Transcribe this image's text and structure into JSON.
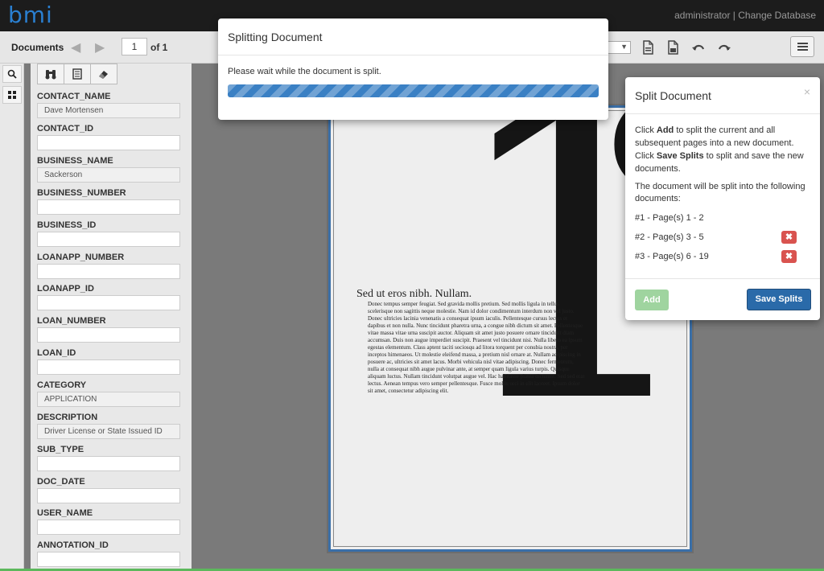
{
  "header": {
    "logo_text": "bmi",
    "user_links": "administrator | Change Database"
  },
  "toolbar": {
    "title": "Documents",
    "page_value": "1",
    "page_of": "of 1"
  },
  "fields": [
    {
      "label": "CONTACT_NAME",
      "value": "Dave Mortensen"
    },
    {
      "label": "CONTACT_ID",
      "value": ""
    },
    {
      "label": "BUSINESS_NAME",
      "value": "Sackerson"
    },
    {
      "label": "BUSINESS_NUMBER",
      "value": ""
    },
    {
      "label": "BUSINESS_ID",
      "value": ""
    },
    {
      "label": "LOANAPP_NUMBER",
      "value": ""
    },
    {
      "label": "LOANAPP_ID",
      "value": ""
    },
    {
      "label": "LOAN_NUMBER",
      "value": ""
    },
    {
      "label": "LOAN_ID",
      "value": ""
    },
    {
      "label": "CATEGORY",
      "value": "APPLICATION"
    },
    {
      "label": "DESCRIPTION",
      "value": "Driver License or State Issued ID"
    },
    {
      "label": "SUB_TYPE",
      "value": ""
    },
    {
      "label": "DOC_DATE",
      "value": ""
    },
    {
      "label": "USER_NAME",
      "value": ""
    },
    {
      "label": "ANNOTATION_ID",
      "value": ""
    }
  ],
  "document": {
    "big_number": "1",
    "big_partial": "C",
    "heading": "Sed ut eros nibh. Nullam.",
    "paragraph": "Donec tempus semper feugiat. Sed gravida mollis pretium. Sed mollis ligula in tellus scelerisque non sagittis neque molestie. Nam id dolor condimentum interdum non vel justo. Donec ultricies lacinia venenatis a consequat ipsum iaculis. Pellentesque cursus lectus et dapibus et non nulla. Nunc tincidunt pharetra urna, a congue nibh dictum sit amet. Pellentesque vitae massa vitae urna suscipit auctor. Aliquam sit amet justo posuere ornare tincidunt diam accumsan. Duis non augue imperdiet suscipit. Praesent vel tincidunt nisi. Nulla libero ea ipsum egestas elementum. Class aptent taciti sociosqu ad litora torquent per conubia nostra, per inceptos himenaeos. Ut molestie eleifend massa, a pretium nisl ornare at. Nullam adipiscing in posuere ac, ultricies sit amet lacus. Morbi vehicula nisl vitae adipiscing. Donec fermentum, nulla at consequat nibh augue pulvinar ante, at semper quam ligula varius turpis. Quisque aliquam luctus. Nullam tincidunt volutpat augue vel. Hac habitasse platea dictumst. Sed sed erat lectus. Aenean tempus vero semper pellentesque. Fusce mollis orci in elit laoreet. Ipsum dolor sit amet, consectetur adipiscing elit."
  },
  "splitting_modal": {
    "title": "Splitting Document",
    "message": "Please wait while the document is split.",
    "progress_percent": 100
  },
  "split_panel": {
    "title": "Split Document",
    "close": "×",
    "instr_1": "Click ",
    "instr_add": "Add",
    "instr_2": " to split the current and all subsequent pages into a new document. Click ",
    "instr_save": "Save Splits",
    "instr_3": " to split and save the new documents.",
    "info": "The document will be split into the following documents:",
    "splits": [
      {
        "label": "#1 - Page(s) 1 - 2",
        "deletable": false
      },
      {
        "label": "#2 - Page(s) 3 - 5",
        "deletable": true
      },
      {
        "label": "#3 - Page(s) 6 - 19",
        "deletable": true
      }
    ],
    "add_label": "Add",
    "save_label": "Save Splits"
  },
  "colors": {
    "accent_blue": "#2a6aa9",
    "delete_red": "#d9534f",
    "add_green": "#9fd49f",
    "progress_blue": "#3a80c4"
  }
}
